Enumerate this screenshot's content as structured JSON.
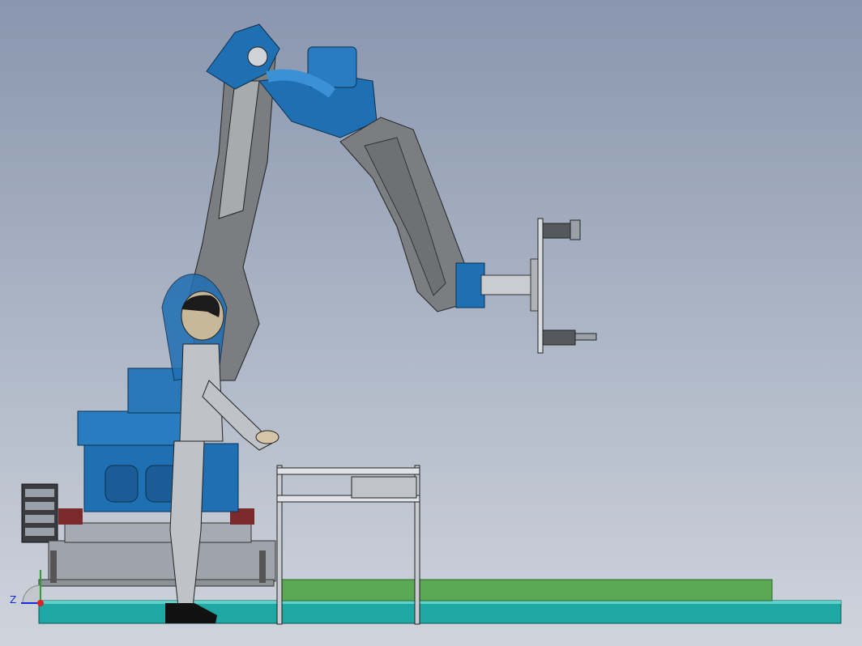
{
  "viewport": {
    "background_top": "#8996ae",
    "background_bottom": "#cfd4dc"
  },
  "colors": {
    "robot_blue": "#1f6fb3",
    "arm_gray": "#7b7d80",
    "floor_teal": "#1fa7a3",
    "green_mat": "#5aa854",
    "frame_gray": "#c8cbd0",
    "manikin_silver": "#bfc2c6"
  },
  "triad": {
    "z_label": "Z"
  }
}
